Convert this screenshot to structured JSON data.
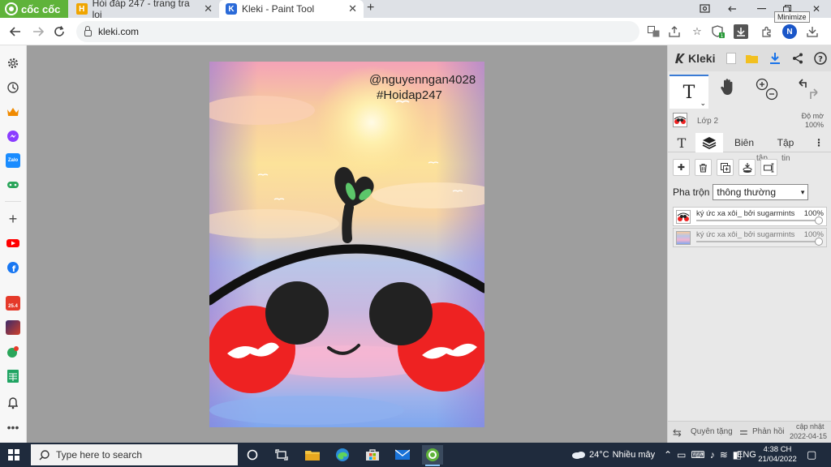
{
  "browser": {
    "brand": "cốc cốc",
    "tabs": [
      {
        "title": "Hỏi đáp 247 - trang tra loi",
        "favicon": "H"
      },
      {
        "title": "Kleki - Paint Tool",
        "favicon": "K"
      }
    ],
    "new_tab": "+",
    "tooltip": "Minimize",
    "url": "kleki.com",
    "profile_initial": "N",
    "extension_badge": "1"
  },
  "sidebar": {
    "items": [
      "settings-icon",
      "history-icon",
      "crown-icon",
      "messenger-icon",
      "zalo-icon",
      "games-icon",
      "add-icon",
      "youtube-icon",
      "facebook-icon",
      "shopping-icon",
      "game-app-icon",
      "quiz-icon",
      "sheets-icon",
      "bell-icon",
      "more-icon"
    ],
    "badges": {
      "zalo": "Zalo",
      "shopping": "25.4"
    }
  },
  "canvas": {
    "watermark_line1": "@nguyenngan4028",
    "watermark_line2": "#Hoidap247"
  },
  "kleki": {
    "logo": "Kleki",
    "layer_name": "Lớp 2",
    "opacity_label": "Độ mờ",
    "opacity_value": "100%",
    "tabs": {
      "brush": "T",
      "edit": "Biên",
      "file": "Tập"
    },
    "tab_overflow": {
      "tap": "tập",
      "tin": "tin"
    },
    "blend_label": "Pha trộn",
    "blend_value": "thông thường",
    "layers": [
      {
        "name": "ký ức xa xôi_ bởi sugarmints",
        "opacity": "100%"
      },
      {
        "name": "ký ức xa xôi_ bởi sugarmints",
        "opacity": "100%"
      }
    ],
    "bottom": {
      "rotate": "Quyên tặng",
      "feedback": "Phản hồi",
      "update_label": "cập nhật",
      "update_date": "2022-04-15"
    }
  },
  "taskbar": {
    "search_placeholder": "Type here to search",
    "weather_temp": "24°C",
    "weather_text": "Nhiều mây",
    "language": "ENG",
    "time": "4:38 CH",
    "date": "21/04/2022"
  }
}
